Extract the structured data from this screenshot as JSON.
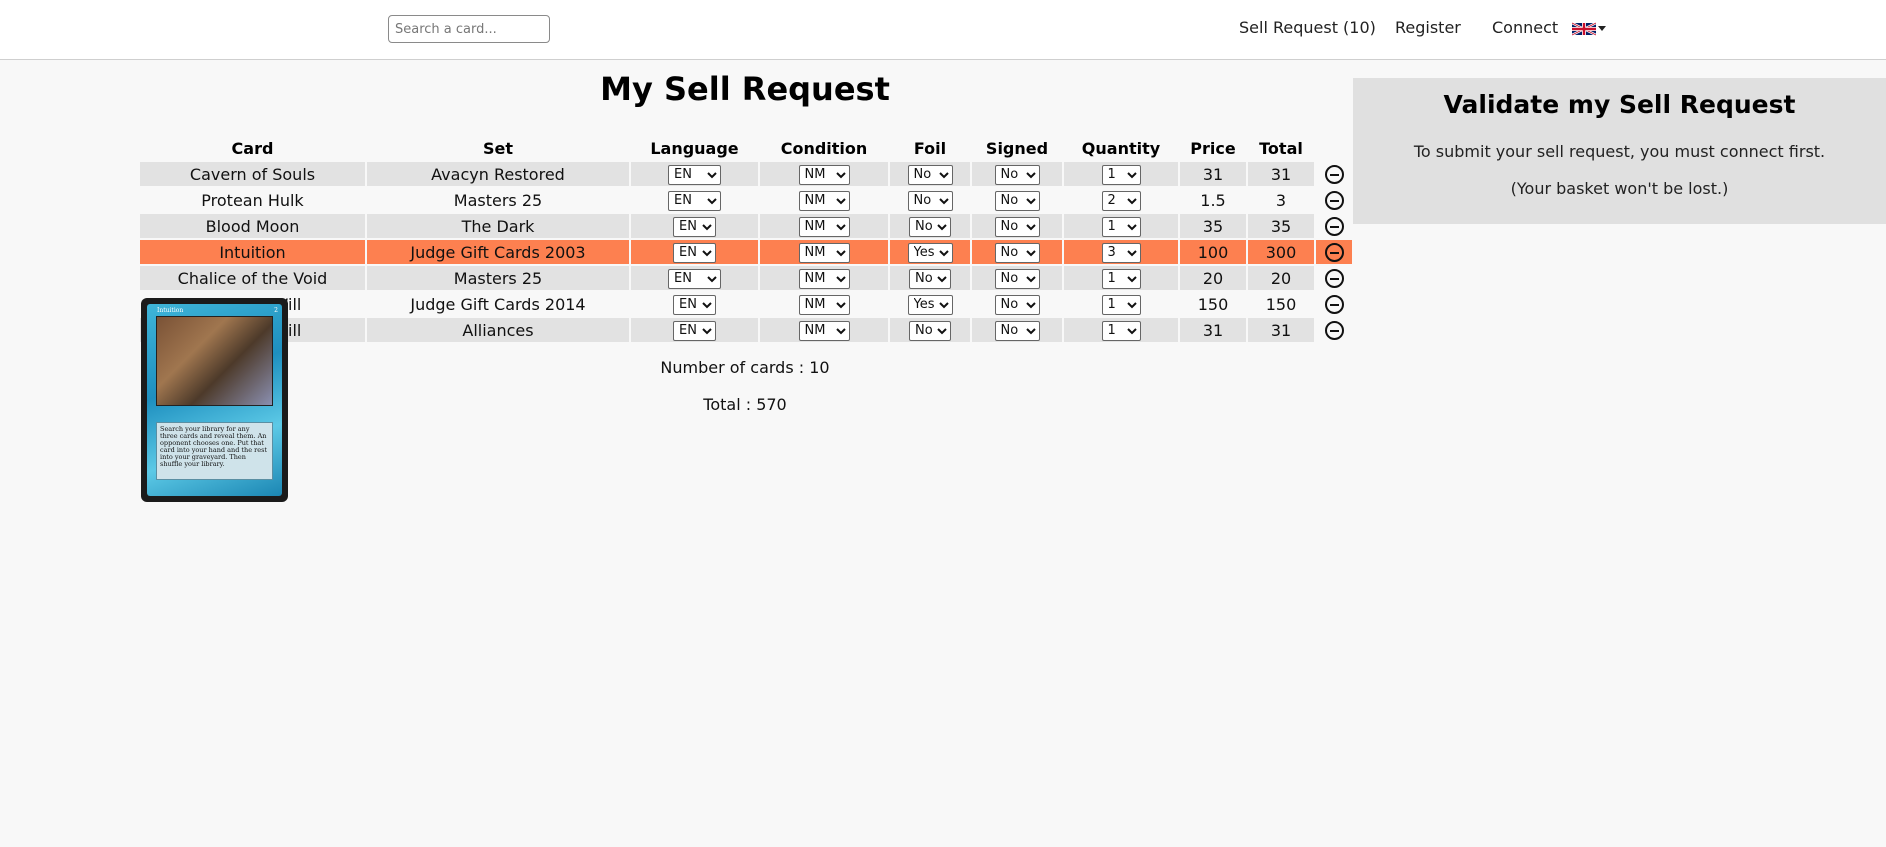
{
  "header": {
    "search_placeholder": "Search a card...",
    "nav": {
      "sell_request": "Sell Request (10)",
      "register": "Register",
      "connect": "Connect"
    },
    "language_icon": "uk-flag-icon"
  },
  "main": {
    "title": "My Sell Request",
    "columns": [
      "Card",
      "Set",
      "Language",
      "Condition",
      "Foil",
      "Signed",
      "Quantity",
      "Price",
      "Total"
    ],
    "rows": [
      {
        "card": "Cavern of Souls",
        "set": "Avacyn Restored",
        "language": "EN",
        "condition": "NM",
        "foil": "No",
        "signed": "No",
        "quantity": "1",
        "price": "31",
        "total": "31"
      },
      {
        "card": "Protean Hulk",
        "set": "Masters 25",
        "language": "EN",
        "condition": "NM",
        "foil": "No",
        "signed": "No",
        "quantity": "2",
        "price": "1.5",
        "total": "3"
      },
      {
        "card": "Blood Moon",
        "set": "The Dark",
        "language": "EN",
        "condition": "NM",
        "foil": "No",
        "signed": "No",
        "quantity": "1",
        "price": "35",
        "total": "35"
      },
      {
        "card": "Intuition",
        "set": "Judge Gift Cards 2003",
        "language": "EN",
        "condition": "NM",
        "foil": "Yes",
        "signed": "No",
        "quantity": "3",
        "price": "100",
        "total": "300"
      },
      {
        "card": "Chalice of the Void",
        "set": "Masters 25",
        "language": "EN",
        "condition": "NM",
        "foil": "No",
        "signed": "No",
        "quantity": "1",
        "price": "20",
        "total": "20"
      },
      {
        "card": "Force of Will",
        "set": "Judge Gift Cards 2014",
        "language": "EN",
        "condition": "NM",
        "foil": "Yes",
        "signed": "No",
        "quantity": "1",
        "price": "150",
        "total": "150"
      },
      {
        "card": "Force of Will",
        "set": "Alliances",
        "language": "EN",
        "condition": "NM",
        "foil": "No",
        "signed": "No",
        "quantity": "1",
        "price": "31",
        "total": "31"
      }
    ],
    "remove_icon": "minus-circle-icon",
    "number_of_cards": "Number of cards : 10",
    "total": "Total : 570",
    "highlight_color": "#fd8050"
  },
  "card_preview": {
    "name": "Intuition",
    "cost": "2",
    "rules_text": "Search your library for any three cards and reveal them. An opponent chooses one. Put that card into your hand and the rest into your graveyard. Then shuffle your library."
  },
  "validate": {
    "title": "Validate my Sell Request",
    "message": "To submit your sell request, you must connect first.",
    "note": "(Your basket won't be lost.)"
  }
}
